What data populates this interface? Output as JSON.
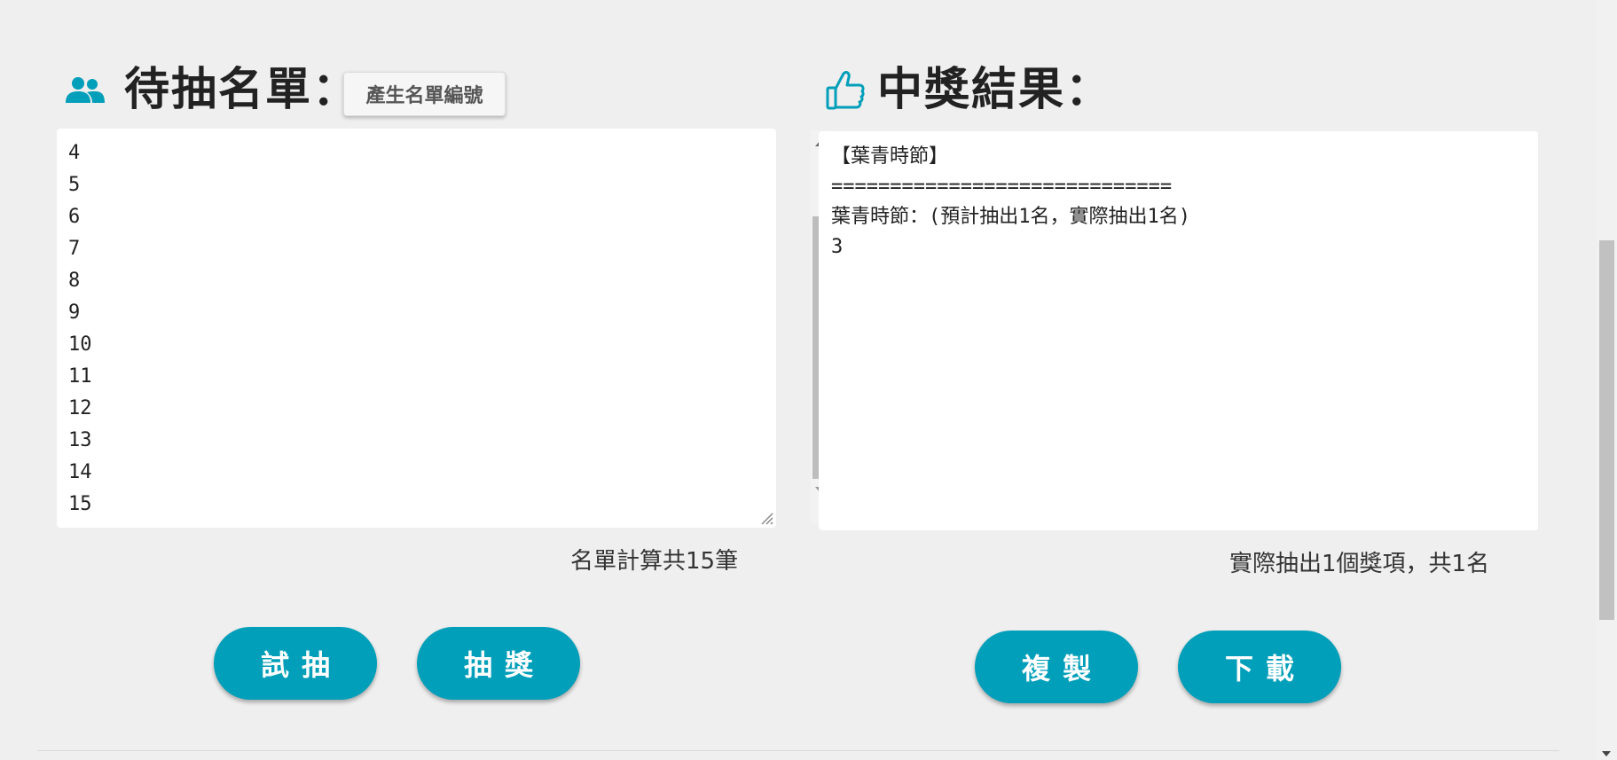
{
  "left_panel": {
    "title": "待抽名單：",
    "icon": "people-icon",
    "generate_button": "產生名單編號",
    "list_items": [
      "4",
      "5",
      "6",
      "7",
      "8",
      "9",
      "10",
      "11",
      "12",
      "13",
      "14",
      "15"
    ],
    "count_text": "名單計算共15筆",
    "buttons": {
      "trial": "試抽",
      "draw": "抽獎"
    }
  },
  "right_panel": {
    "title": "中獎結果：",
    "icon": "thumbs-up-icon",
    "result_lines": [
      "【葉青時節】",
      "=============================",
      "葉青時節：(預計抽出1名，實際抽出1名)",
      "3"
    ],
    "summary_text": "實際抽出1個獎項，共1名",
    "buttons": {
      "copy": "複製",
      "download": "下載"
    }
  },
  "colors": {
    "accent": "#019fb9",
    "background": "#efefef"
  }
}
